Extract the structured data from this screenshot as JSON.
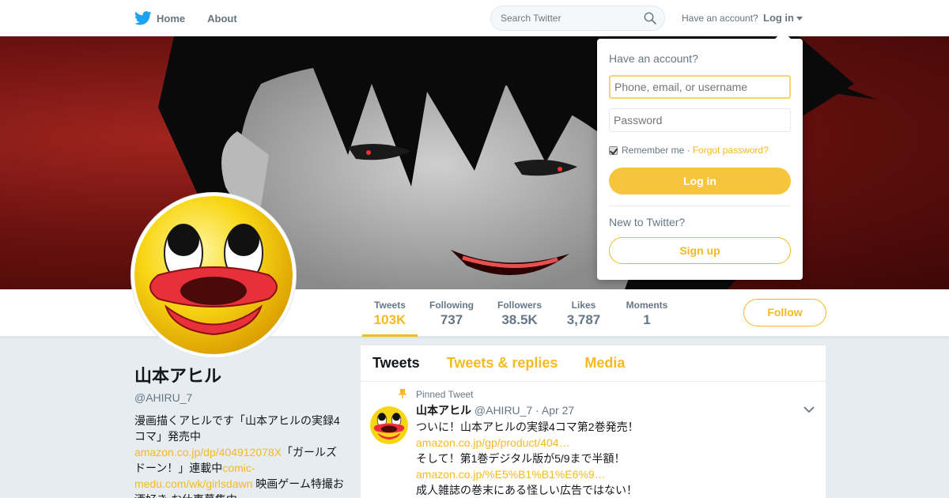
{
  "nav": {
    "home_label": "Home",
    "about_label": "About",
    "search_placeholder": "Search Twitter",
    "have_account": "Have an account?",
    "login_label": "Log in"
  },
  "colors": {
    "accent": "#f5b921",
    "login_button": "#f7c53b",
    "banner_red": "#8a1a16"
  },
  "stats": [
    {
      "label": "Tweets",
      "value": "103K"
    },
    {
      "label": "Following",
      "value": "737"
    },
    {
      "label": "Followers",
      "value": "38.5K"
    },
    {
      "label": "Likes",
      "value": "3,787"
    },
    {
      "label": "Moments",
      "value": "1"
    }
  ],
  "follow_label": "Follow",
  "profile": {
    "display_name": "山本アヒル",
    "screen_name": "@AHIRU_7",
    "bio_text_1": "漫画描くアヒルです「山本アヒルの実録4コマ」発売中",
    "bio_link_1": "amazon.co.jp/dp/404912078X",
    "bio_text_2": "「ガールズドーン！」連載中",
    "bio_link_2": "comic-medu.com/wk/girlsdawn",
    "bio_text_3": " 映画ゲーム特撮お酒好き お仕事募集中"
  },
  "tabs": [
    {
      "label": "Tweets"
    },
    {
      "label": "Tweets & replies"
    },
    {
      "label": "Media"
    }
  ],
  "tweet": {
    "pinned_label": "Pinned Tweet",
    "name": "山本アヒル",
    "handle": "@AHIRU_7",
    "time": "· Apr 27",
    "line_1": "ついに！山本アヒルの実録4コマ第2巻発売！",
    "link_1": "amazon.co.jp/gp/product/404…",
    "line_2": "そして！第1巻デジタル版が5/9まで半額！",
    "link_2": "amazon.co.jp/%E5%B1%B1%E6%9…",
    "line_3": "成人雑誌の巻末にある怪しい広告ではない！"
  },
  "login_dropdown": {
    "title": "Have an account?",
    "username_placeholder": "Phone, email, or username",
    "password_placeholder": "Password",
    "remember_label": "Remember me",
    "separator": "·",
    "forgot_label": "Forgot password?",
    "login_button": "Log in",
    "new_label": "New to Twitter?",
    "signup_button": "Sign up"
  }
}
